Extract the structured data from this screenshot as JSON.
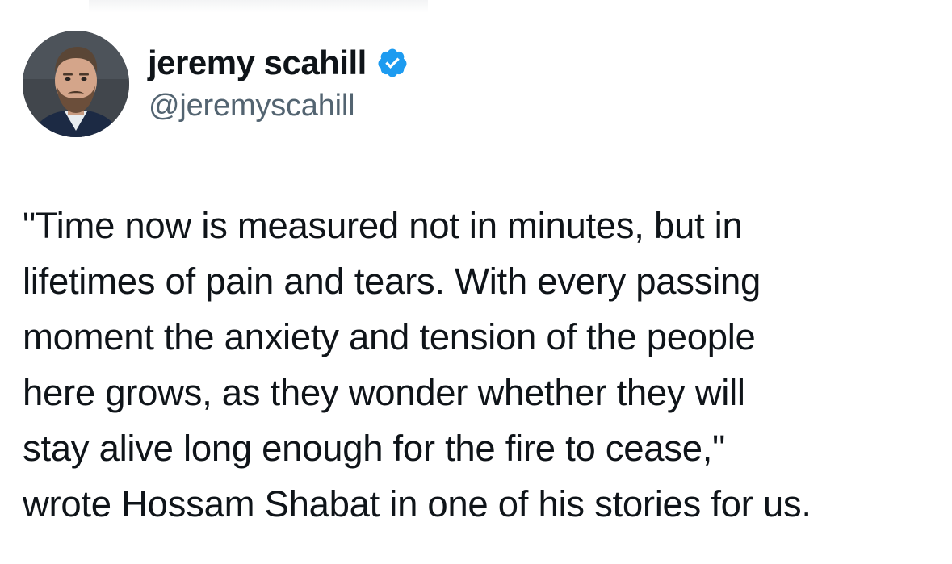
{
  "tweet": {
    "author": {
      "display_name": "jeremy scahill",
      "handle": "@jeremyscahill",
      "verified": true,
      "verified_color": "#1d9bf0",
      "avatar_icon": "profile-photo"
    },
    "text_lines": [
      "\"Time now is measured not in minutes, but in",
      "lifetimes of pain and tears. With every passing",
      "moment the anxiety and tension of the people",
      "here grows, as they wonder whether they will",
      "stay alive long enough for the fire to cease,\"",
      "wrote Hossam Shabat in one of his stories for us."
    ]
  }
}
